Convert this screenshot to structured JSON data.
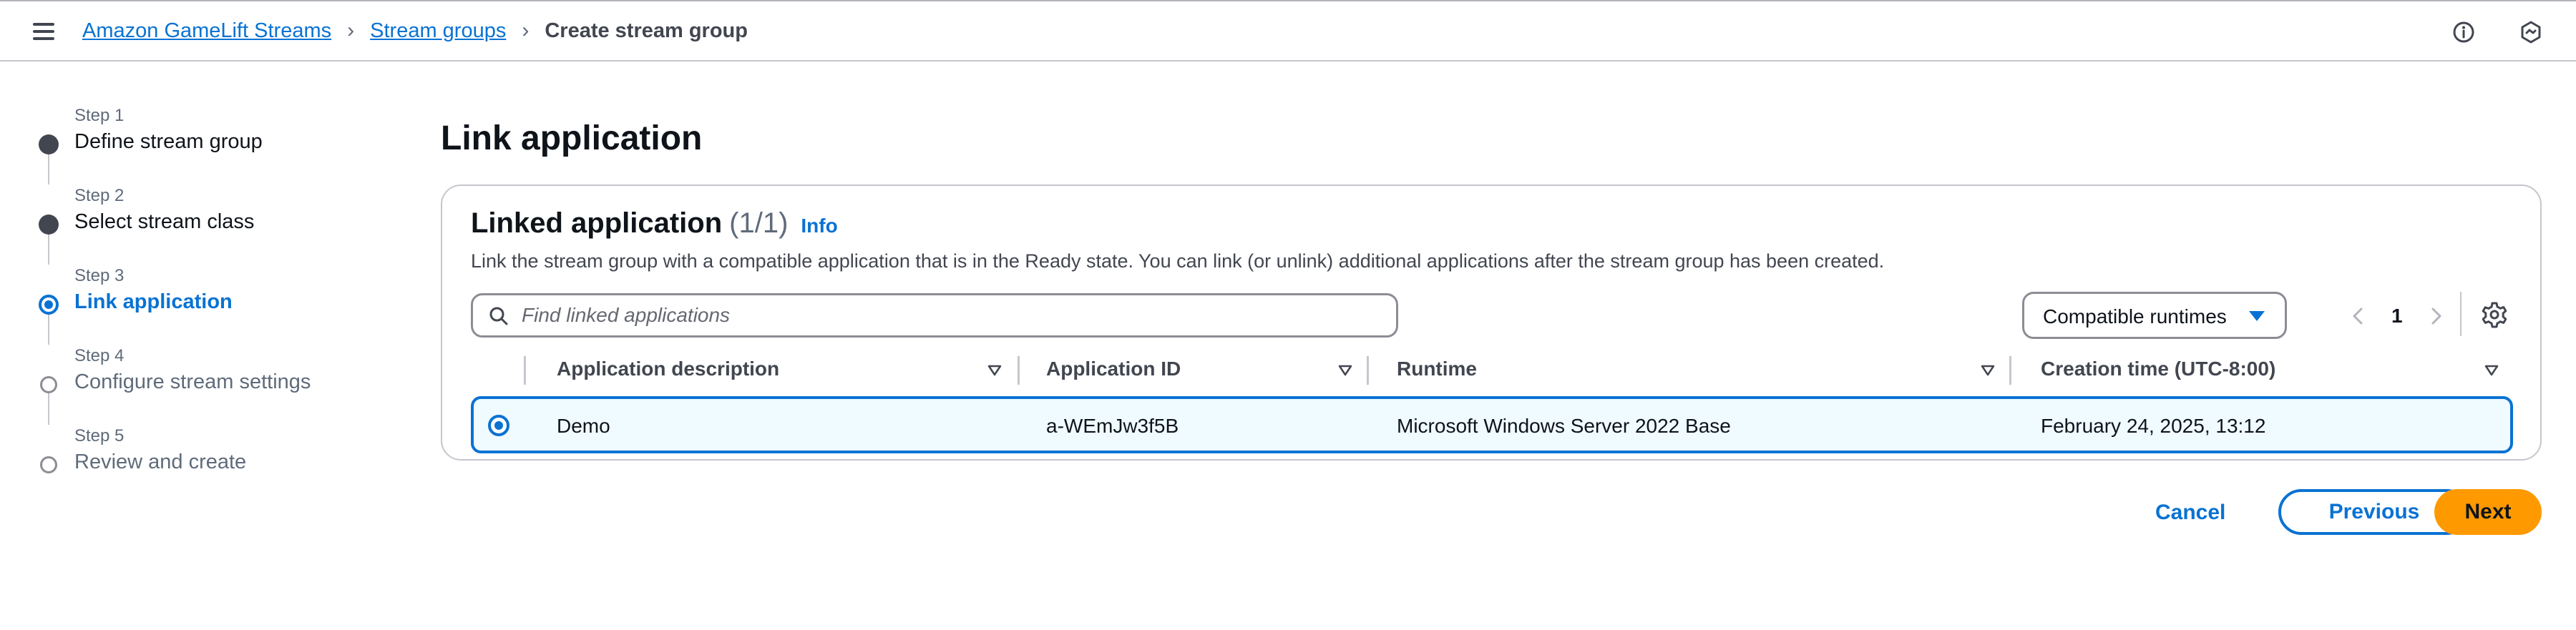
{
  "breadcrumb": {
    "items": [
      {
        "label": "Amazon GameLift Streams"
      },
      {
        "label": "Stream groups"
      }
    ],
    "current": "Create stream group"
  },
  "header_icons": [
    "info-circle-icon",
    "notifications-hexagon-icon"
  ],
  "wizard": {
    "steps": [
      {
        "number": "Step 1",
        "title": "Define stream group",
        "state": "completed"
      },
      {
        "number": "Step 2",
        "title": "Select stream class",
        "state": "completed"
      },
      {
        "number": "Step 3",
        "title": "Link application",
        "state": "current"
      },
      {
        "number": "Step 4",
        "title": "Configure stream settings",
        "state": "upcoming"
      },
      {
        "number": "Step 5",
        "title": "Review and create",
        "state": "upcoming"
      }
    ]
  },
  "page": {
    "title": "Link application"
  },
  "container": {
    "title": "Linked application",
    "count": "(1/1)",
    "info_link": "Info",
    "description": "Link the stream group with a compatible application that is in the Ready state. You can link (or unlink) additional applications after the stream group has been created."
  },
  "search": {
    "placeholder": "Find linked applications",
    "value": ""
  },
  "filter": {
    "selected": "Compatible runtimes"
  },
  "pagination": {
    "current_page": "1"
  },
  "table": {
    "columns": [
      "Application description",
      "Application ID",
      "Runtime",
      "Creation time (UTC-8:00)"
    ],
    "rows": [
      {
        "selected": true,
        "description": "Demo",
        "id": "a-WEmJw3f5B",
        "runtime": "Microsoft Windows Server 2022 Base",
        "created": "February 24, 2025, 13:12"
      }
    ]
  },
  "actions": {
    "cancel": "Cancel",
    "previous": "Previous",
    "next": "Next"
  },
  "colors": {
    "accent": "#0972d3",
    "primary_button": "#ff9900",
    "selected_row_bg": "#f0fbff",
    "text": "#0f141a"
  }
}
